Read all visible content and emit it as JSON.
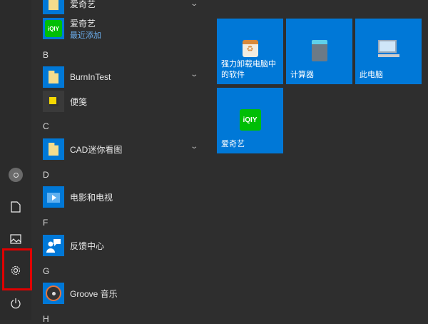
{
  "rail": {
    "items": [
      "user",
      "documents",
      "pictures",
      "settings",
      "power"
    ]
  },
  "list": {
    "items": [
      {
        "label": "爱奇艺",
        "type": "folder"
      },
      {
        "label": "爱奇艺",
        "sub": "最近添加",
        "type": "iqiyi"
      },
      {
        "label": "BurnInTest",
        "type": "folder"
      },
      {
        "label": "便笺",
        "type": "sticky"
      },
      {
        "label": "CAD迷你看图",
        "type": "folder"
      },
      {
        "label": "电影和电视",
        "type": "movies"
      },
      {
        "label": "反馈中心",
        "type": "feedback"
      },
      {
        "label": "Groove 音乐",
        "type": "groove"
      }
    ],
    "headers": [
      "B",
      "C",
      "D",
      "F",
      "G",
      "H"
    ]
  },
  "tiles": [
    {
      "label": "强力卸载电脑中的软件"
    },
    {
      "label": "计算器"
    },
    {
      "label": "此电脑"
    },
    {
      "label": "爱奇艺"
    }
  ],
  "iqiyi_text": "iQIY",
  "colors": {
    "accent": "#0078d7",
    "highlight": "#e00000"
  }
}
